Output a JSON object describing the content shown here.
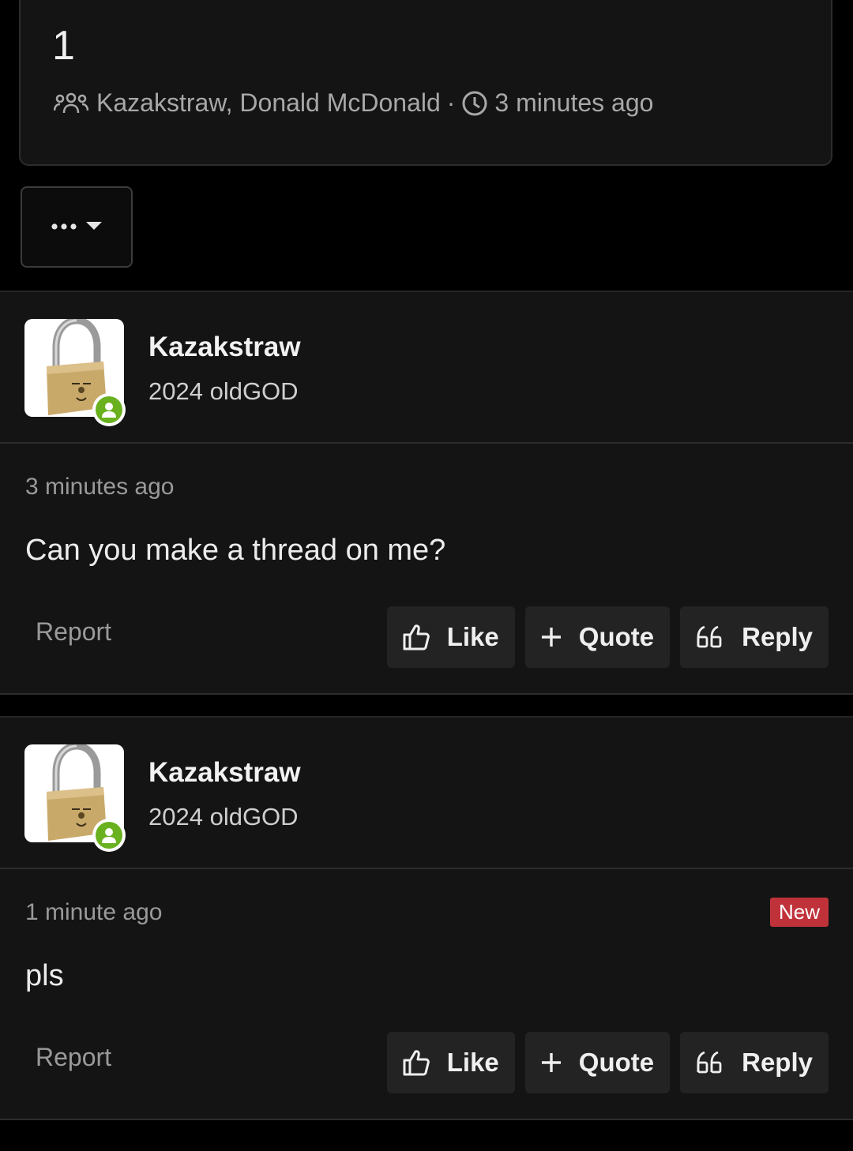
{
  "thread": {
    "title": "1",
    "participants": "Kazakstraw, Donald McDonald",
    "separator": "·",
    "time": "3 minutes ago",
    "participants_icon": "users-icon",
    "time_icon": "clock-icon"
  },
  "menu_button": {
    "icon": "ellipsis-icon",
    "caret": "caret-down-icon"
  },
  "posts": [
    {
      "username": "Kazakstraw",
      "user_title": "2024 oldGOD",
      "avatar": "padlock-avatar",
      "time": "3 minutes ago",
      "content": "Can you make a thread on me?",
      "badge": "",
      "report": "Report",
      "like": "Like",
      "quote": "Quote",
      "reply": "Reply"
    },
    {
      "username": "Kazakstraw",
      "user_title": "2024 oldGOD",
      "avatar": "padlock-avatar",
      "time": "1 minute ago",
      "content": "pls",
      "badge": "New",
      "report": "Report",
      "like": "Like",
      "quote": "Quote",
      "reply": "Reply"
    }
  ],
  "colors": {
    "background": "#000000",
    "card": "#141414",
    "button": "#232323",
    "online": "#6ab11f",
    "new_badge": "#c0323a"
  }
}
